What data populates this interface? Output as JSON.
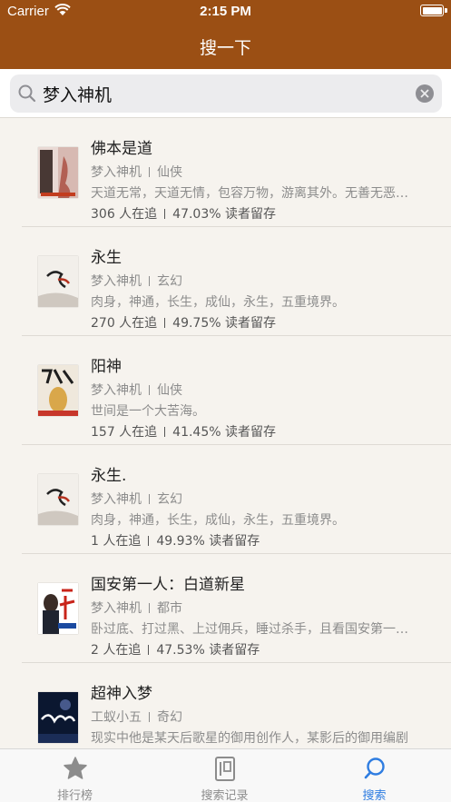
{
  "status_bar": {
    "carrier": "Carrier",
    "time": "2:15 PM"
  },
  "nav": {
    "title": "搜一下"
  },
  "search": {
    "value": "梦入神机"
  },
  "results": [
    {
      "title": "佛本是道",
      "author": "梦入神机",
      "category": "仙侠",
      "description": "天道无常，天道无情，包容万物，游离其外。无善无恶，无是无非",
      "readers": "306 人在追",
      "retention": "47.03% 读者留存"
    },
    {
      "title": "永生",
      "author": "梦入神机",
      "category": "玄幻",
      "description": "肉身，神通，长生，成仙，永生，五重境界。",
      "readers": "270 人在追",
      "retention": "49.75% 读者留存"
    },
    {
      "title": "阳神",
      "author": "梦入神机",
      "category": "仙侠",
      "description": "世间是一个大苦海。",
      "readers": "157 人在追",
      "retention": "41.45% 读者留存"
    },
    {
      "title": "永生.",
      "author": "梦入神机",
      "category": "玄幻",
      "description": "肉身，神通，长生，成仙，永生，五重境界。",
      "readers": "1 人在追",
      "retention": "49.93% 读者留存"
    },
    {
      "title": "国安第一人：白道新星",
      "author": "梦入神机",
      "category": "都市",
      "description": "卧过底、打过黑、上过佣兵，睡过杀手，且看国安第一人如何",
      "readers": "2 人在追",
      "retention": "47.53% 读者留存"
    },
    {
      "title": "超神入梦",
      "author": "工蚁小五",
      "category": "奇幻",
      "description": "现实中他是某天后歌星的御用创作人，某影后的御用编剧",
      "readers": "",
      "retention": ""
    }
  ],
  "tabbar": {
    "tabs": [
      {
        "label": "排行榜",
        "icon": "star-icon"
      },
      {
        "label": "搜索记录",
        "icon": "book-icon"
      },
      {
        "label": "搜索",
        "icon": "search-icon"
      }
    ],
    "active_index": 2
  },
  "colors": {
    "nav_bar": "#9b4f14",
    "active_tab": "#2f7de1",
    "background": "#f6f3ee"
  }
}
